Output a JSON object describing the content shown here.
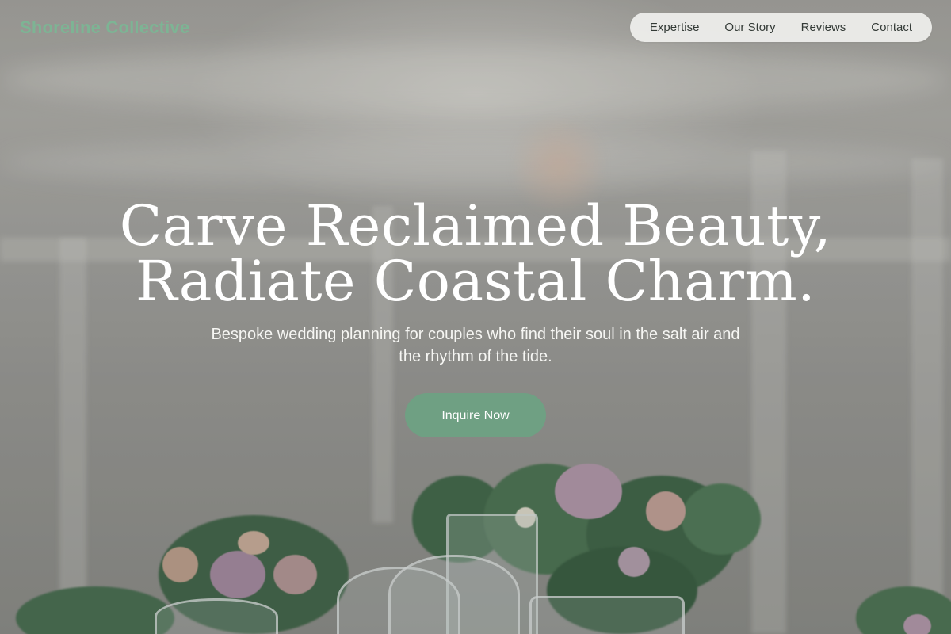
{
  "brand": {
    "name": "Shoreline Collective",
    "color": "#7db494"
  },
  "nav": {
    "items": [
      "Expertise",
      "Our Story",
      "Reviews",
      "Contact"
    ]
  },
  "hero": {
    "title_line1": "Carve Reclaimed Beauty,",
    "title_line2": "Radiate Coastal Charm.",
    "subtitle": "Bespoke wedding planning for couples who find their soul in the salt air and the rhythm of the tide.",
    "cta_label": "Inquire Now",
    "cta_color": "#6fa083"
  }
}
